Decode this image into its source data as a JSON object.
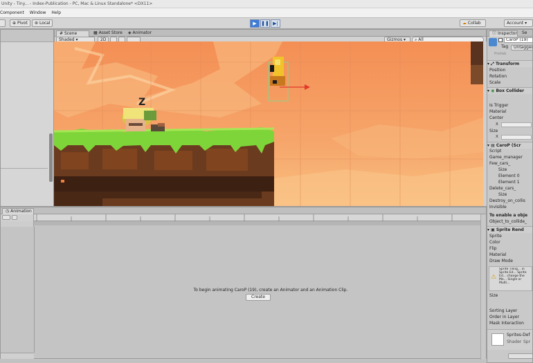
{
  "window": {
    "title": "Unity - Tiny... - Index-Publication - PC, Mac & Linux Standalone* <DX11>"
  },
  "menu": [
    "Component",
    "Window",
    "Help"
  ],
  "toolbar": {
    "pivot": "Pivot",
    "local": "Local",
    "collab": "Collab",
    "account": "Account"
  },
  "scene_tabs": {
    "scene": "Scene",
    "asset_store": "Asset Store",
    "animator": "Animator"
  },
  "scene_toolbar": {
    "shading": "Shaded",
    "mode_2d": "2D",
    "gizmos": "Gizmos",
    "search": "All"
  },
  "sleep_symbol": "Z",
  "animation": {
    "tab": "Animation",
    "preview": "Preview",
    "message": "To begin animating CaroP (19), create an Animator and an Animation Clip.",
    "create_button": "Create"
  },
  "inspector": {
    "tab": "Inspector",
    "tab2": "Se",
    "object_name": "CaroP (19)",
    "tag_label": "Tag",
    "tag_value": "Untagged",
    "prefab_row": "Prefab",
    "transform": "Transform",
    "transform_fields": [
      "Position",
      "Rotation",
      "Scale"
    ],
    "box_collider": "Box Collider",
    "box_fields": [
      "Is Trigger",
      "Material",
      "Center",
      "X",
      "Size",
      "X"
    ],
    "script": "CaroP (Scr",
    "script_fields": [
      "Script",
      "Game_manager",
      "Few_cars_",
      "Size",
      "Element 0",
      "Element 1",
      "Delete_cars_",
      "Size",
      "Destroy_on_collis",
      "Invisible"
    ],
    "enable_note": "To enable a obje",
    "enable_sub": "Object_to_collide_",
    "sprite_renderer": "Sprite Rend",
    "sprite_fields": [
      "Sprite",
      "Color",
      "Flip",
      "Material",
      "Draw Mode"
    ],
    "warning": "Sprite Tiling... in Sprite Ed... Sprite Ed... change the Me... Single or Multi...",
    "sprite_fields2": [
      "Size",
      "Sorting Layer",
      "Order in Layer",
      "Mask Interaction"
    ],
    "material_name": "Sprites-Def",
    "material_sub": "Shader",
    "material_sub2": "Spr"
  },
  "colors": {
    "sky": "#f4a468",
    "grass": "#7ed53a",
    "dirt": "#6b3b1f",
    "select": "#3d7bd8"
  }
}
